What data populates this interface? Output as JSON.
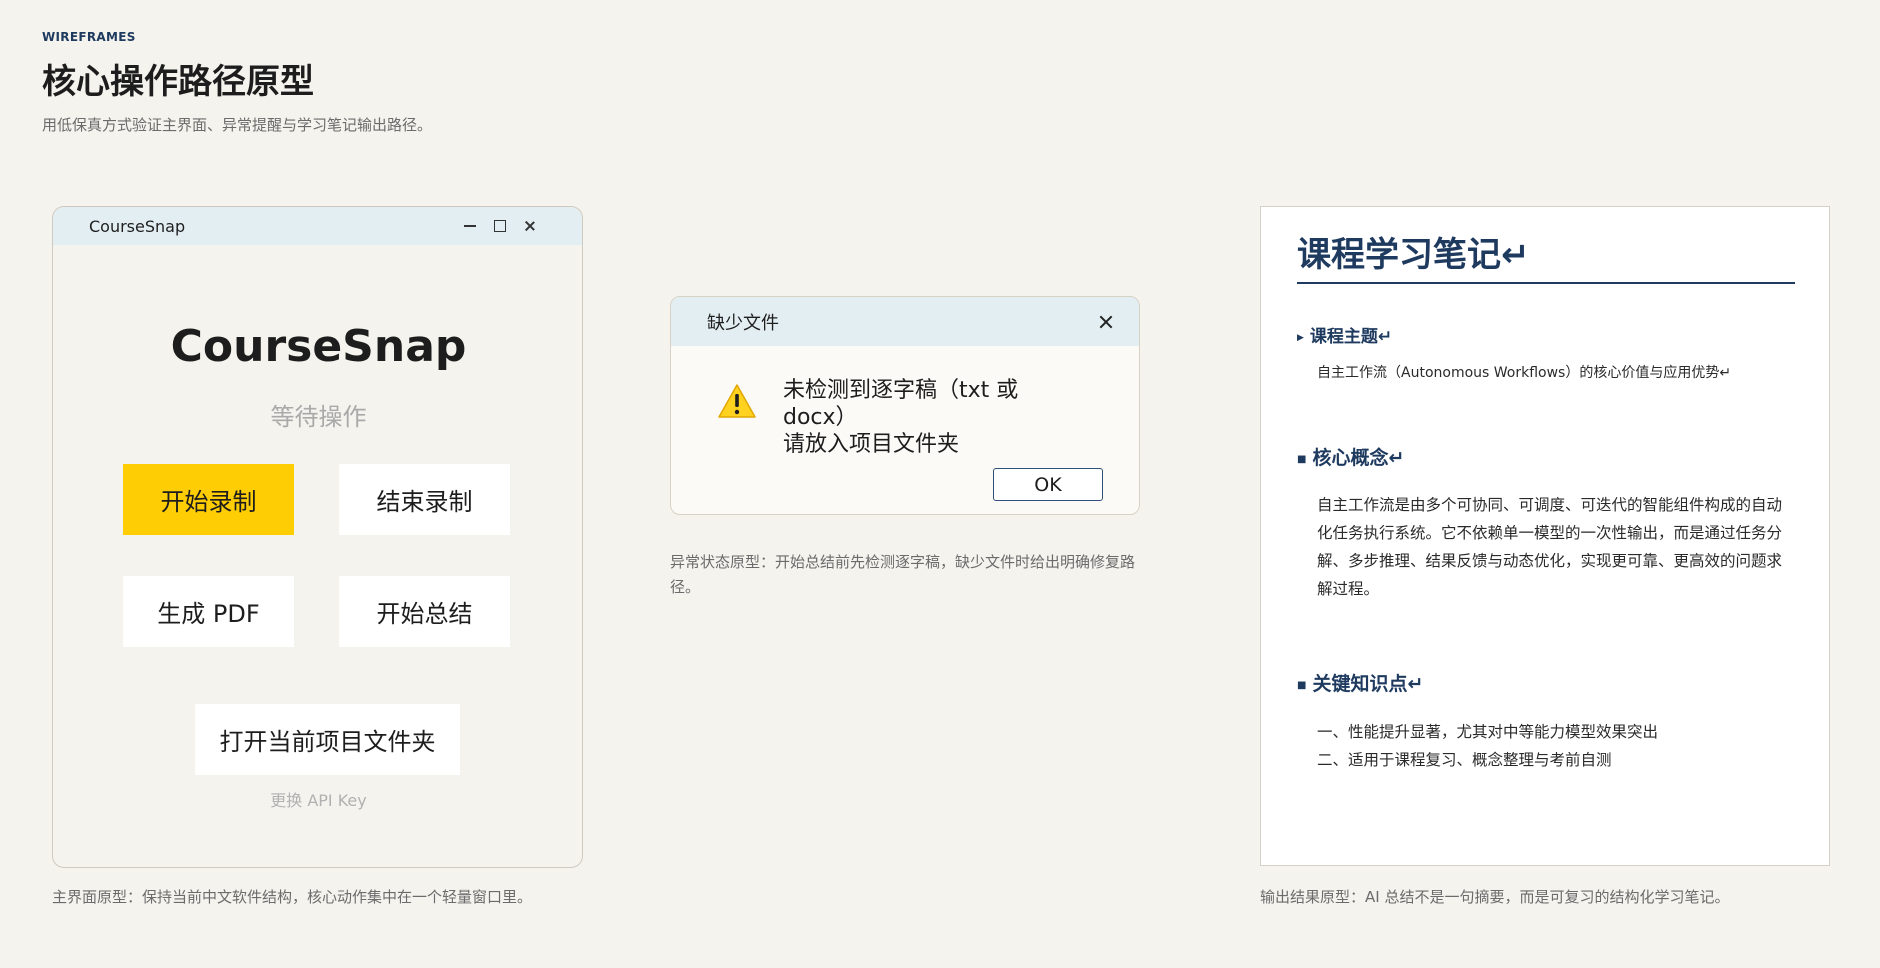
{
  "header": {
    "eyebrow": "WIREFRAMES",
    "title": "核心操作路径原型",
    "subtitle": "用低保真方式验证主界面、异常提醒与学习笔记输出路径。"
  },
  "main_window": {
    "titlebar_title": "CourseSnap",
    "app_name": "CourseSnap",
    "status": "等待操作",
    "buttons": {
      "start_recording": "开始录制",
      "stop_recording": "结束录制",
      "generate_pdf": "生成 PDF",
      "start_summary": "开始总结",
      "open_folder": "打开当前项目文件夹"
    },
    "api_key_link": "更换 API Key",
    "caption": "主界面原型：保持当前中文软件结构，核心动作集中在一个轻量窗口里。",
    "accent_color": "#fecd04"
  },
  "dialog": {
    "title": "缺少文件",
    "message_line1": "未检测到逐字稿（txt 或",
    "message_line2": "docx）",
    "message_line3": "请放入项目文件夹",
    "ok_label": "OK",
    "icon": "warning-icon",
    "caption": "异常状态原型：开始总结前先检测逐字稿，缺少文件时给出明确修复路径。"
  },
  "notes": {
    "title": "课程学习笔记↵",
    "section1_title": "课程主题↵",
    "section1_body": "自主工作流（Autonomous Workflows）的核心价值与应用优势↵",
    "section2_title": "核心概念↵",
    "section2_body": "自主工作流是由多个可协同、可调度、可迭代的智能组件构成的自动化任务执行系统。它不依赖单一模型的一次性输出，而是通过任务分解、多步推理、结果反馈与动态优化，实现更可靠、更高效的问题求解过程。",
    "section3_title": "关键知识点↵",
    "section3_items": [
      "一、性能提升显著，尤其对中等能力模型效果突出",
      "二、适用于课程复习、概念整理与考前自测"
    ],
    "caption": "输出结果原型：AI 总结不是一句摘要，而是可复习的结构化学习笔记。",
    "heading_color": "#1e3a5f"
  }
}
